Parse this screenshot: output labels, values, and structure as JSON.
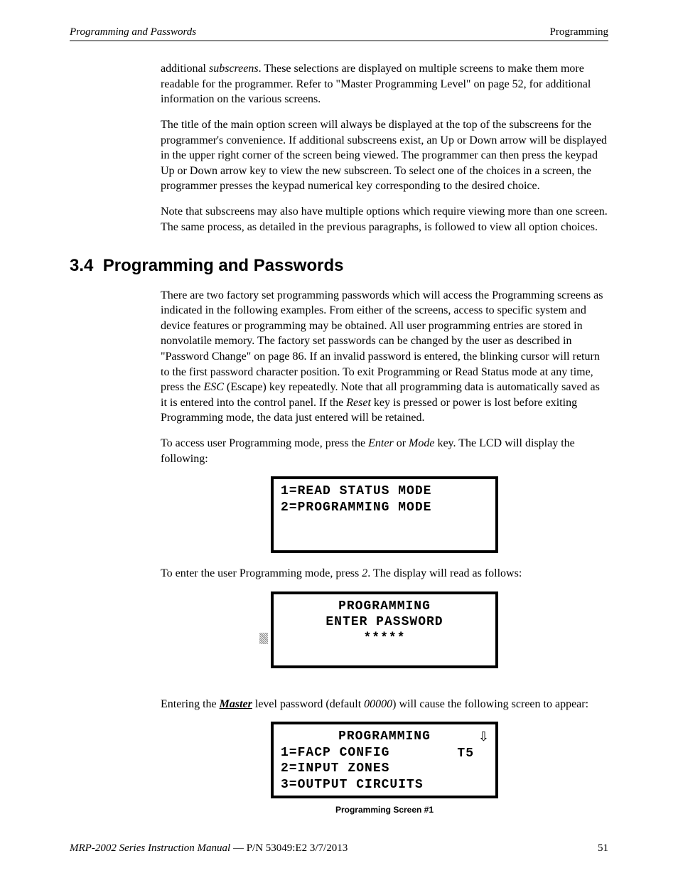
{
  "header": {
    "left": "Programming and Passwords",
    "right": "Programming"
  },
  "intro": {
    "p1a": "additional ",
    "p1b": "subscreens",
    "p1c": ".  These selections are displayed on multiple screens to make them more readable for the programmer.  Refer to \"Master Programming Level\" on page 52, for additional information on the various screens.",
    "p2": "The title of the main option screen will always be displayed at the top of the subscreens for the programmer's convenience.  If additional subscreens exist, an Up or Down arrow will be displayed in the upper right corner of the screen being viewed.  The programmer can then press the keypad Up or Down arrow key to view the new subscreen.  To select one of the choices in a screen, the programmer presses the keypad numerical key corresponding to the desired choice.",
    "p3": "Note that subscreens may also have multiple options which require viewing more than one screen.  The same process, as detailed in the previous paragraphs, is followed to view all option choices."
  },
  "section": {
    "number": "3.4",
    "title": "Programming and Passwords"
  },
  "body": {
    "p4a": "There are two factory set programming passwords which will access the Programming screens as indicated in the following examples.  From either of the screens, access to specific system and device features or programming may be obtained.  All user programming entries are stored in nonvolatile memory.  The factory set passwords can be changed by the user as described in \"Password Change\" on page 86.  If an invalid password is entered, the blinking cursor will return to the first password character position.  To exit Programming or  Read Status mode at any time, press the ",
    "p4b": "ESC",
    "p4c": " (Escape) key repeatedly.  Note that all programming data is automatically saved as it is entered into the control panel.  If the ",
    "p4d": "Reset",
    "p4e": " key is pressed or power is lost before exiting Programming mode, the data just entered will be retained.",
    "p5a": "To access user Programming mode, press the ",
    "p5b": "Enter",
    "p5c": " or ",
    "p5d": "Mode",
    "p5e": " key.  The LCD will display the following:",
    "p6a": "To enter the user Programming mode, press ",
    "p6b": "2",
    "p6c": ".  The display will read as follows:",
    "p7a": "Entering the ",
    "p7b": "Master",
    "p7c": " level password (default ",
    "p7d": "00000",
    "p7e": ") will cause the following screen to appear:"
  },
  "lcd1": {
    "line1": "1=READ STATUS MODE",
    "line2": "2=PROGRAMMING MODE"
  },
  "lcd2": {
    "line1": "PROGRAMMING",
    "line2": "ENTER PASSWORD",
    "line3": "*****"
  },
  "lcd3": {
    "line1": "PROGRAMMING",
    "line2": "1=FACP CONFIG",
    "line3": "2=INPUT ZONES",
    "line4": "3=OUTPUT CIRCUITS",
    "t5": "T5",
    "arrow": "⇩",
    "caption": "Programming Screen #1"
  },
  "footer": {
    "manual": "MRP-2002 Series Instruction Manual",
    "pn": " — P/N 53049:E2  3/7/2013",
    "page": "51"
  }
}
